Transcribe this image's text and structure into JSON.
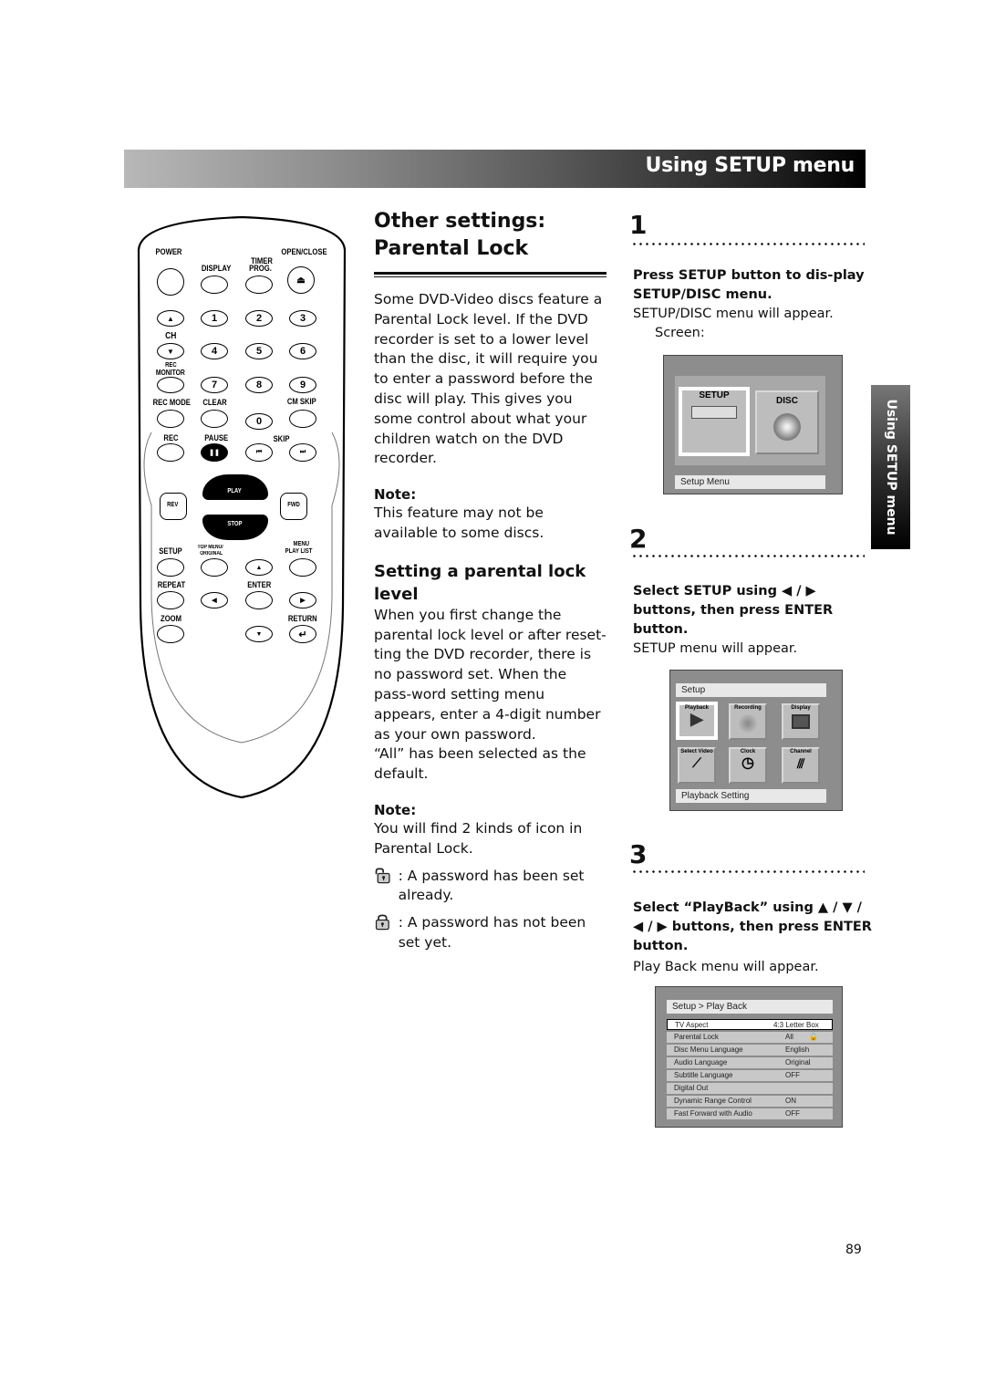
{
  "header": {
    "title": "Using SETUP menu"
  },
  "side_tab": {
    "label": "Using SETUP menu"
  },
  "remote": {
    "labels": {
      "power": "POWER",
      "display": "DISPLAY",
      "timer": "TIMER",
      "prog": "PROG.",
      "open_close": "OPEN/CLOSE",
      "ch": "CH",
      "rec_monitor_1": "REC",
      "rec_monitor_2": "MONITOR",
      "rec_mode": "REC MODE",
      "clear": "CLEAR",
      "cm_skip": "CM SKIP",
      "rec": "REC",
      "pause": "PAUSE",
      "skip": "SKIP",
      "play": "PLAY",
      "stop": "STOP",
      "rev": "REV",
      "fwd": "FWD",
      "setup": "SETUP",
      "top_menu_1": "TOP MENU/",
      "top_menu_2": "ORIGINAL",
      "menu_1": "MENU",
      "menu_2": "PLAY LIST",
      "repeat": "REPEAT",
      "enter": "ENTER",
      "zoom": "ZOOM",
      "return": "RETURN"
    },
    "digits": [
      "1",
      "2",
      "3",
      "4",
      "5",
      "6",
      "7",
      "8",
      "9",
      "0"
    ]
  },
  "main": {
    "title_line1": "Other settings:",
    "title_line2": "Parental Lock",
    "intro": "Some DVD-Video discs feature a Parental Lock level. If the DVD recorder is set to a lower level than the disc, it will require you to enter a password before the disc will play. This gives you some control about what your children watch on the DVD recorder.",
    "note1_heading": "Note:",
    "note1_text": "This feature may not be available to some discs.",
    "section_heading": "Setting a parental lock level",
    "section_text": "When you first change the parental lock level or after reset-ting the DVD recorder, there is no password set. When the pass-word setting menu appears, enter a 4-digit number as your own password.",
    "default_text": "“All” has been selected as the default.",
    "note2_heading": "Note:",
    "note2_text": "You will find 2 kinds of icon in Parental Lock.",
    "icons": [
      {
        "icon": "unlocked-padlock-icon",
        "text": ": A password has been set already."
      },
      {
        "icon": "locked-padlock-icon",
        "text": ": A password has not been set yet."
      }
    ]
  },
  "steps": [
    {
      "number": "1",
      "bold": "Press SETUP button to dis-play SETUP/DISC menu.",
      "body": "SETUP/DISC menu will appear.",
      "extra": "Screen:",
      "screen": {
        "tiles": [
          "SETUP",
          "DISC"
        ],
        "status": "Setup Menu"
      }
    },
    {
      "number": "2",
      "bold": "Select SETUP using ◀ / ▶ buttons, then press ENTER button.",
      "body": "SETUP menu will appear.",
      "screen": {
        "title": "Setup",
        "tiles": [
          "Playback",
          "Recording",
          "Display",
          "Select Video",
          "Clock",
          "Channel"
        ],
        "status": "Playback Setting"
      }
    },
    {
      "number": "3",
      "bold": "Select “PlayBack” using ▲ / ▼ / ◀ / ▶ buttons, then press ENTER button.",
      "body": "Play Back menu will appear.",
      "screen": {
        "title": "Setup > Play Back",
        "rows": [
          {
            "label": "TV Aspect",
            "value": "4:3 Letter Box"
          },
          {
            "label": "Parental Lock",
            "value": "All"
          },
          {
            "label": "Disc Menu Language",
            "value": "English"
          },
          {
            "label": "Audio Language",
            "value": "Original"
          },
          {
            "label": "Subtitle Language",
            "value": "OFF"
          },
          {
            "label": "Digital Out",
            "value": ""
          },
          {
            "label": "Dynamic Range Control",
            "value": "ON"
          },
          {
            "label": "Fast Forward with Audio",
            "value": "OFF"
          }
        ]
      }
    }
  ],
  "page_number": "89"
}
